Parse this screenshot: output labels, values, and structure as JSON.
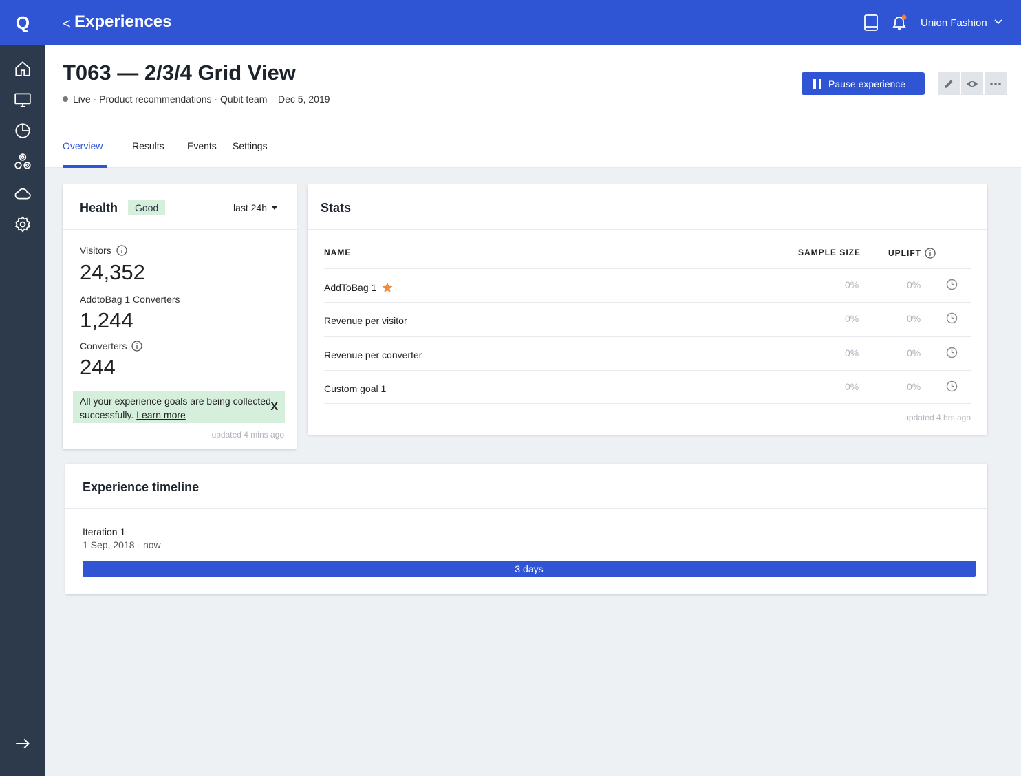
{
  "app": {
    "logo": "Q",
    "page_heading": "Experiences",
    "back_symbol": "<",
    "org_name": "Union Fashion",
    "accent_color": "#2f55d4"
  },
  "sidebar": {
    "items": [
      {
        "icon": "home-icon"
      },
      {
        "icon": "monitor-icon"
      },
      {
        "icon": "pie-chart-icon"
      },
      {
        "icon": "segments-icon"
      },
      {
        "icon": "cloud-icon"
      },
      {
        "icon": "settings-icon"
      }
    ],
    "expand_icon": "arrow-right-icon"
  },
  "experience": {
    "title": "T063 — 2/3/4 Grid View",
    "status": "Live",
    "meta": "Live · Product recommendations · Qubit team – Dec 5, 2019",
    "pause_label": "Pause experience"
  },
  "tabs": [
    {
      "label": "Overview",
      "active": true
    },
    {
      "label": "Results",
      "active": false
    },
    {
      "label": "Events",
      "active": false
    },
    {
      "label": "Settings",
      "active": false
    }
  ],
  "health": {
    "title": "Health",
    "badge": "Good",
    "range": "last 24h",
    "metrics": [
      {
        "label": "Visitors",
        "value": "24,352",
        "info": true
      },
      {
        "label": "AddtoBag 1 Converters",
        "value": "1,244",
        "info": false
      },
      {
        "label": "Converters",
        "value": "244",
        "info": true
      }
    ],
    "note_text": "All your experience goals are being collected successfully.",
    "note_link": "Learn more",
    "note_close": "X",
    "updated": "updated 4 mins ago"
  },
  "stats": {
    "title": "Stats",
    "columns": {
      "name": "NAME",
      "sample": "SAMPLE SIZE",
      "uplift": "UPLIFT"
    },
    "rows": [
      {
        "name": "AddToBag 1",
        "sample": "0%",
        "uplift": "0%",
        "primary": true
      },
      {
        "name": "Revenue per visitor",
        "sample": "0%",
        "uplift": "0%",
        "primary": false
      },
      {
        "name": "Revenue per converter",
        "sample": "0%",
        "uplift": "0%",
        "primary": false
      },
      {
        "name": "Custom goal 1",
        "sample": "0%",
        "uplift": "0%",
        "primary": false
      }
    ],
    "updated": "updated 4 hrs ago"
  },
  "timeline": {
    "title": "Experience timeline",
    "iteration": "Iteration 1",
    "dates": "1 Sep, 2018 - now",
    "duration": "3 days"
  }
}
